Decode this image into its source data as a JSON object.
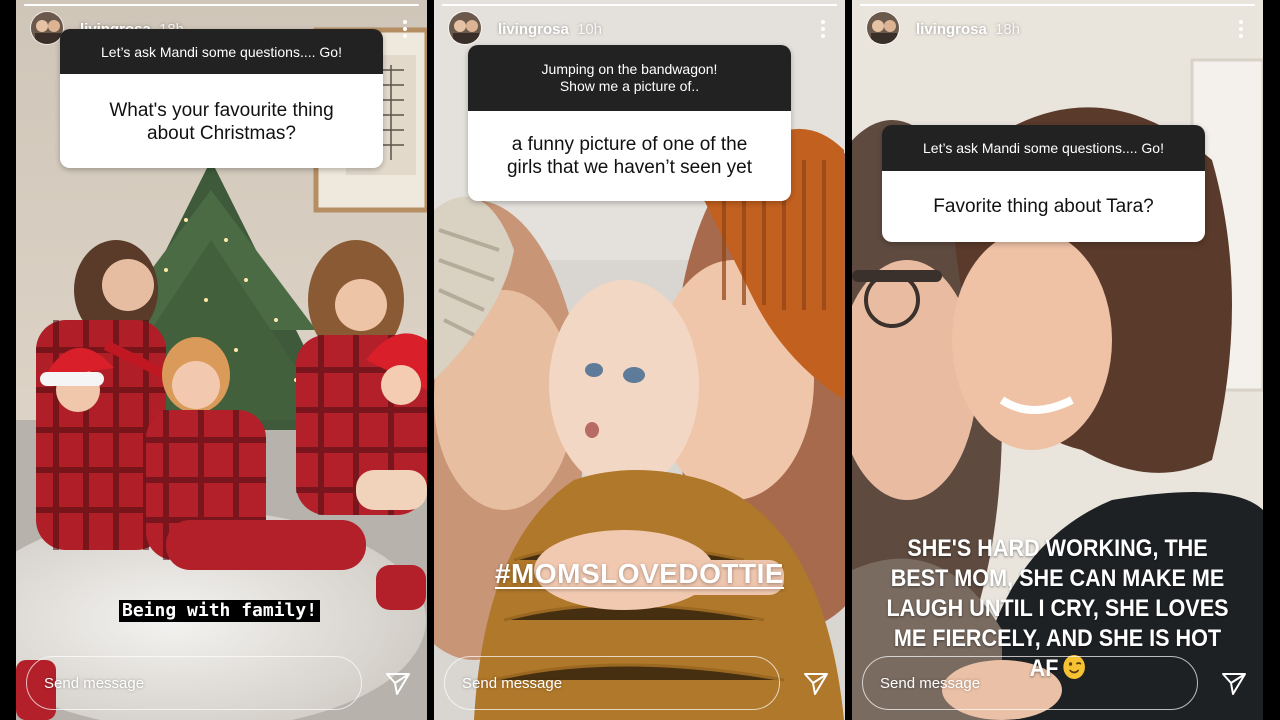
{
  "stories": [
    {
      "username": "livingrosa",
      "time_ago": "18h",
      "progress": 1,
      "question_prompt": "Let’s ask Mandi some questions.... Go!",
      "question_text": "What's your favourite thing about Christmas?",
      "caption": "Being with family!",
      "send_placeholder": "Send message"
    },
    {
      "username": "livingrosa",
      "time_ago": "10h",
      "progress": 1,
      "question_prompt": "Jumping on the bandwagon! Show me a picture of..",
      "question_text": "a funny picture of one of the girls that we haven’t seen yet",
      "caption": "#MOMSLOVEDOTTIE",
      "send_placeholder": "Send message"
    },
    {
      "username": "livingrosa",
      "time_ago": "18h",
      "progress": 1,
      "question_prompt": "Let’s ask Mandi some questions.... Go!",
      "question_text": "Favorite thing about Tara?",
      "caption": "SHE'S HARD WORKING, THE BEST MOM, SHE CAN MAKE ME LAUGH UNTIL I CRY, SHE LOVES ME FIERCELY, AND SHE IS HOT AF",
      "send_placeholder": "Send message"
    }
  ],
  "icons": {
    "more": "more-vertical-icon",
    "share": "paper-plane-icon",
    "emoji": "winking-face-emoji"
  },
  "colors": {
    "question_header_bg": "#222222",
    "question_body_bg": "#ffffff",
    "text_white": "#ffffff"
  }
}
